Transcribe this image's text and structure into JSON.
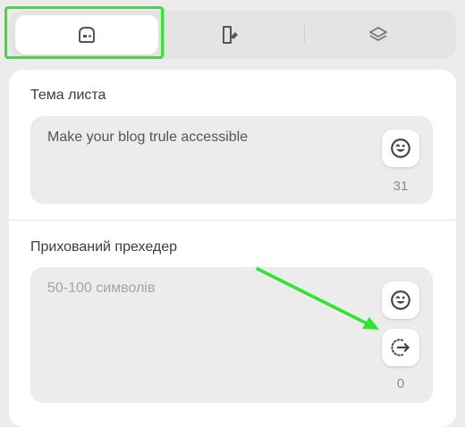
{
  "tabs": [
    {
      "icon": "mail-card-icon",
      "active": true
    },
    {
      "icon": "document-pen-icon",
      "active": false
    },
    {
      "icon": "layers-icon",
      "active": false
    }
  ],
  "subject": {
    "label": "Тема листа",
    "value": "Make your blog trule accessible",
    "counter": "31"
  },
  "preheader": {
    "label": "Прихований прехедер",
    "placeholder": "50-100 символів",
    "counter": "0"
  },
  "annotations": {
    "highlight_color": "#2ee62e"
  }
}
